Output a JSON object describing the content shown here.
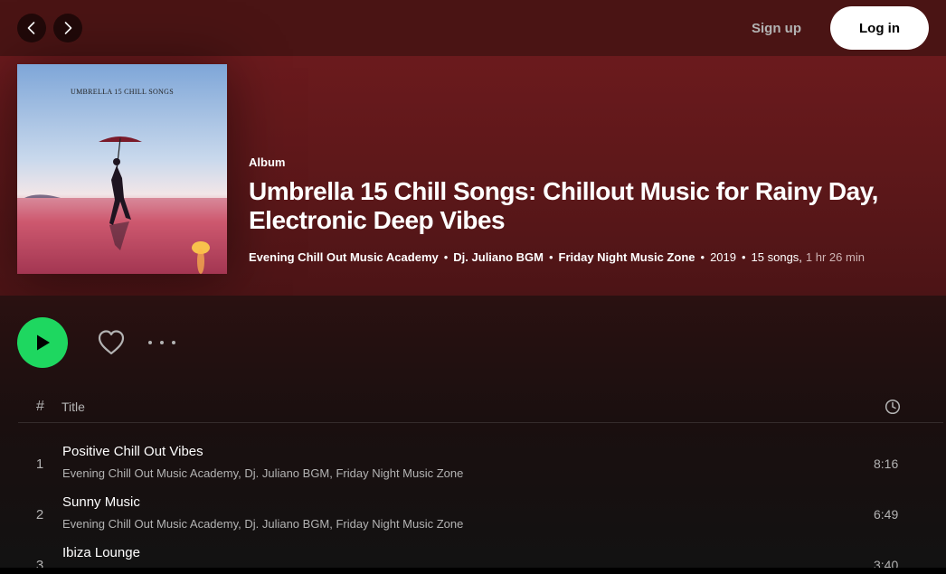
{
  "topbar": {
    "signup_label": "Sign up",
    "login_label": "Log in"
  },
  "cover": {
    "caption": "UMBRELLA 15 CHILL SONGS"
  },
  "album": {
    "type_label": "Album",
    "title": "Umbrella 15 Chill Songs: Chillout Music for Rainy Day, Electronic Deep Vibes",
    "artists": [
      "Evening Chill Out Music Academy",
      "Dj. Juliano BGM",
      "Friday Night Music Zone"
    ],
    "year": "2019",
    "song_count": "15 songs,",
    "duration": "1 hr 26 min"
  },
  "table": {
    "hash_label": "#",
    "title_label": "Title"
  },
  "tracks": [
    {
      "num": "1",
      "title": "Positive Chill Out Vibes",
      "artists": "Evening Chill Out Music Academy, Dj. Juliano BGM, Friday Night Music Zone",
      "duration": "8:16"
    },
    {
      "num": "2",
      "title": "Sunny Music",
      "artists": "Evening Chill Out Music Academy, Dj. Juliano BGM, Friday Night Music Zone",
      "duration": "6:49"
    },
    {
      "num": "3",
      "title": "Ibiza Lounge",
      "artists": "",
      "duration": "3:40"
    }
  ],
  "colors": {
    "accent": "#1ed760",
    "header_bg": "#6b1a1d",
    "page_bg": "#121212"
  }
}
